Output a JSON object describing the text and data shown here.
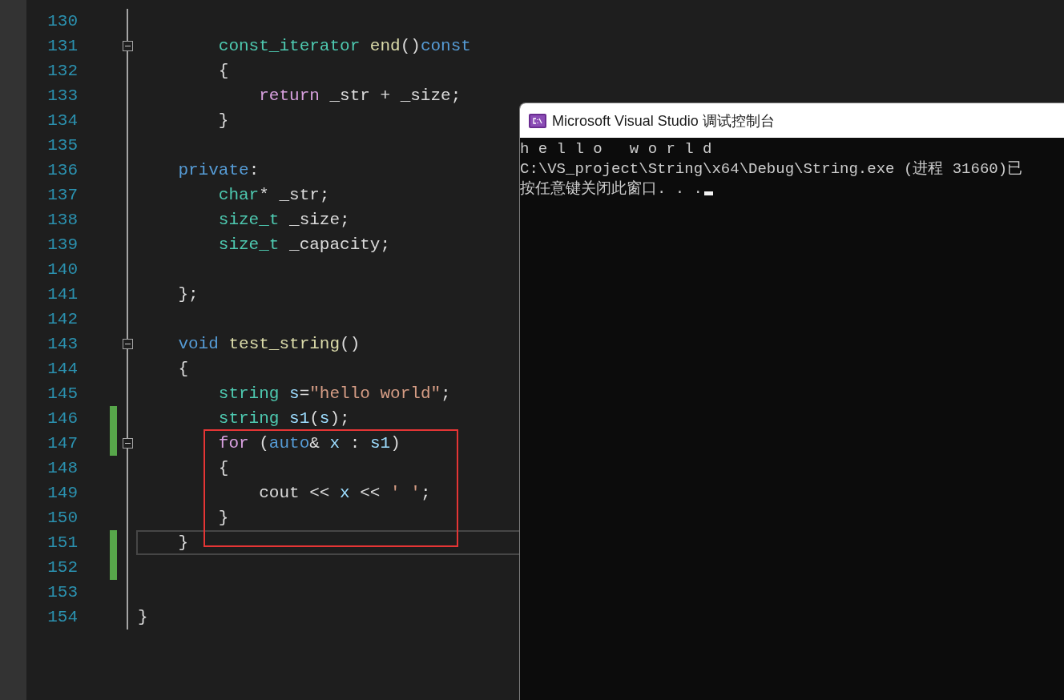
{
  "editor": {
    "lines": [
      {
        "number": "130",
        "changed": false,
        "foldable": false,
        "current": false
      },
      {
        "number": "131",
        "changed": false,
        "foldable": true,
        "current": false,
        "tokens": [
          {
            "kind": "type",
            "text": "        const_iterator"
          },
          {
            "kind": "func",
            "text": " end"
          },
          {
            "kind": "plain",
            "text": "()"
          },
          {
            "kind": "keyword",
            "text": "const"
          }
        ]
      },
      {
        "number": "132",
        "changed": false,
        "foldable": false,
        "current": false,
        "tokens": [
          {
            "kind": "plain",
            "text": "        {"
          }
        ]
      },
      {
        "number": "133",
        "changed": false,
        "foldable": false,
        "current": false,
        "tokens": [
          {
            "kind": "control",
            "text": "            return"
          },
          {
            "kind": "plain",
            "text": " _str + _size;"
          }
        ]
      },
      {
        "number": "134",
        "changed": false,
        "foldable": false,
        "current": false,
        "tokens": [
          {
            "kind": "plain",
            "text": "        }"
          }
        ]
      },
      {
        "number": "135",
        "changed": false,
        "foldable": false,
        "current": false
      },
      {
        "number": "136",
        "changed": false,
        "foldable": false,
        "current": false,
        "tokens": [
          {
            "kind": "keyword",
            "text": "    private"
          },
          {
            "kind": "plain",
            "text": ":"
          }
        ]
      },
      {
        "number": "137",
        "changed": false,
        "foldable": false,
        "current": false,
        "tokens": [
          {
            "kind": "type",
            "text": "        char"
          },
          {
            "kind": "plain",
            "text": "* _str;"
          }
        ]
      },
      {
        "number": "138",
        "changed": false,
        "foldable": false,
        "current": false,
        "tokens": [
          {
            "kind": "type",
            "text": "        size_t"
          },
          {
            "kind": "plain",
            "text": " _size;"
          }
        ]
      },
      {
        "number": "139",
        "changed": false,
        "foldable": false,
        "current": false,
        "tokens": [
          {
            "kind": "type",
            "text": "        size_t"
          },
          {
            "kind": "plain",
            "text": " _capacity;"
          }
        ]
      },
      {
        "number": "140",
        "changed": false,
        "foldable": false,
        "current": false
      },
      {
        "number": "141",
        "changed": false,
        "foldable": false,
        "current": false,
        "tokens": [
          {
            "kind": "plain",
            "text": "    };"
          }
        ]
      },
      {
        "number": "142",
        "changed": false,
        "foldable": false,
        "current": false
      },
      {
        "number": "143",
        "changed": false,
        "foldable": true,
        "current": false,
        "tokens": [
          {
            "kind": "keyword",
            "text": "    void"
          },
          {
            "kind": "func",
            "text": " test_string"
          },
          {
            "kind": "plain",
            "text": "()"
          }
        ]
      },
      {
        "number": "144",
        "changed": false,
        "foldable": false,
        "current": false,
        "tokens": [
          {
            "kind": "plain",
            "text": "    {"
          }
        ]
      },
      {
        "number": "145",
        "changed": false,
        "foldable": false,
        "current": false,
        "tokens": [
          {
            "kind": "type",
            "text": "        string"
          },
          {
            "kind": "ident",
            "text": " s"
          },
          {
            "kind": "plain",
            "text": "="
          },
          {
            "kind": "string",
            "text": "\"hello world\""
          },
          {
            "kind": "plain",
            "text": ";"
          }
        ]
      },
      {
        "number": "146",
        "changed": true,
        "foldable": false,
        "current": false,
        "tokens": [
          {
            "kind": "type",
            "text": "        string"
          },
          {
            "kind": "ident",
            "text": " s1"
          },
          {
            "kind": "plain",
            "text": "("
          },
          {
            "kind": "ident",
            "text": "s"
          },
          {
            "kind": "plain",
            "text": ");"
          }
        ]
      },
      {
        "number": "147",
        "changed": true,
        "foldable": true,
        "current": false,
        "tokens": [
          {
            "kind": "control",
            "text": "        for"
          },
          {
            "kind": "plain",
            "text": " ("
          },
          {
            "kind": "keyword",
            "text": "auto"
          },
          {
            "kind": "plain",
            "text": "& "
          },
          {
            "kind": "ident",
            "text": "x"
          },
          {
            "kind": "plain",
            "text": " : "
          },
          {
            "kind": "ident",
            "text": "s1"
          },
          {
            "kind": "plain",
            "text": ")"
          }
        ]
      },
      {
        "number": "148",
        "changed": false,
        "foldable": false,
        "current": false,
        "tokens": [
          {
            "kind": "plain",
            "text": "        {"
          }
        ]
      },
      {
        "number": "149",
        "changed": false,
        "foldable": false,
        "current": false,
        "tokens": [
          {
            "kind": "plain",
            "text": "            cout << "
          },
          {
            "kind": "ident",
            "text": "x"
          },
          {
            "kind": "plain",
            "text": " << "
          },
          {
            "kind": "string",
            "text": "' '"
          },
          {
            "kind": "plain",
            "text": ";"
          }
        ]
      },
      {
        "number": "150",
        "changed": false,
        "foldable": false,
        "current": false,
        "tokens": [
          {
            "kind": "plain",
            "text": "        }"
          }
        ]
      },
      {
        "number": "151",
        "changed": true,
        "foldable": false,
        "current": true,
        "tokens": [
          {
            "kind": "plain",
            "text": "    }"
          }
        ]
      },
      {
        "number": "152",
        "changed": true,
        "foldable": false,
        "current": false
      },
      {
        "number": "153",
        "changed": false,
        "foldable": false,
        "current": false
      },
      {
        "number": "154",
        "changed": false,
        "foldable": false,
        "current": false,
        "tokens": [
          {
            "kind": "plain",
            "text": "}"
          }
        ]
      }
    ]
  },
  "console": {
    "title": "Microsoft Visual Studio 调试控制台",
    "output": [
      "h e l l o   w o r l d",
      "C:\\VS_project\\String\\x64\\Debug\\String.exe (进程 31660)已",
      "按任意键关闭此窗口. . ."
    ],
    "cursor": true
  }
}
